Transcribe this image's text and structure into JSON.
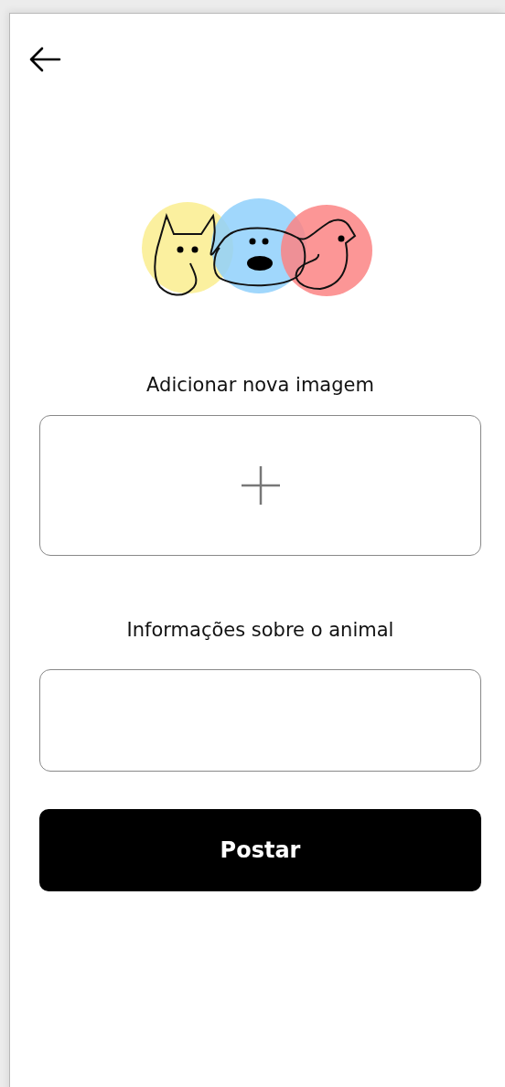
{
  "image_upload": {
    "label": "Adicionar nova imagem"
  },
  "info_field": {
    "label": "Informações sobre o animal"
  },
  "submit_button": {
    "label": "Postar"
  }
}
